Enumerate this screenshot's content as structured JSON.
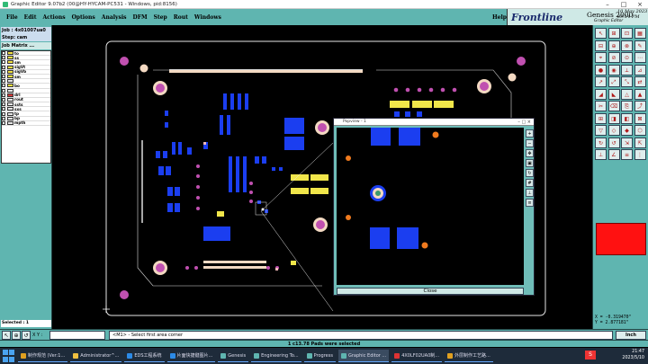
{
  "window": {
    "title": "Graphic Editor 9.07b2 (00@HY-HYCAM-PC531 - Windows, pid:8156)"
  },
  "menu": {
    "file": "File",
    "edit": "Edit",
    "actions": "Actions",
    "options": "Options",
    "analysis": "Analysis",
    "dfm": "DFM",
    "step": "Step",
    "rout": "Rout",
    "windows": "Windows",
    "help": "Help"
  },
  "brand": {
    "name": "Frontline",
    "product": "Genesis 2000",
    "subtitle": "Graphic Editor",
    "date": "10 May 2023",
    "time": "09:14 PM"
  },
  "left": {
    "job": "Job : 4x01007ua0",
    "step": "Step: cam",
    "matrix_title": "Job Matrix ...",
    "layers": [
      {
        "name": "to",
        "color": "yellow"
      },
      {
        "name": "ss",
        "color": "yellow"
      },
      {
        "name": "sm",
        "color": "yellow"
      },
      {
        "name": "sigVt",
        "color": "yellow"
      },
      {
        "name": "sigVb",
        "color": "yellow"
      },
      {
        "name": "sm",
        "color": "yellow"
      },
      {
        "name": "",
        "color": "none"
      },
      {
        "name": "bo",
        "color": "yellow"
      },
      {
        "name": "",
        "color": "none"
      },
      {
        "name": "drl",
        "color": "red"
      },
      {
        "name": "rout",
        "color": "white"
      },
      {
        "name": "ssts",
        "color": "white"
      },
      {
        "name": "sxs",
        "color": "white"
      },
      {
        "name": "tp",
        "color": "white"
      },
      {
        "name": "bp",
        "color": "white"
      },
      {
        "name": "mpth",
        "color": "white"
      }
    ],
    "status": "Selected : 1"
  },
  "popup": {
    "title": "Popview - 1",
    "close": "Close"
  },
  "tools": {
    "coords_x": "X = -0.319470\"",
    "coords_y": "Y = 2.877181\""
  },
  "cmd": {
    "xy_label": "X Y :",
    "input_value": "",
    "message": "<M1> - Select first area corner",
    "units": "Inch"
  },
  "status_line": "1 c13.78 Pads were selected",
  "taskbar": {
    "items": [
      {
        "label": "制作规范 (Ver:1...",
        "color": "#e0a020"
      },
      {
        "label": "Administrator^...",
        "color": "#f0c040"
      },
      {
        "label": "EDS工程系统",
        "color": "#2c8ae6"
      },
      {
        "label": "片面快捷键图片...",
        "color": "#2c8ae6"
      },
      {
        "label": "Genesis",
        "color": "#5fb5b0"
      },
      {
        "label": "Engineering To...",
        "color": "#5fb5b0"
      },
      {
        "label": "Progress",
        "color": "#5fb5b0"
      },
      {
        "label": "Graphic Editor ...",
        "color": "#5fb5b0"
      },
      {
        "label": "4X0LF02UA0制...",
        "color": "#d33"
      },
      {
        "label": "外层制作工艺路...",
        "color": "#e0a020"
      }
    ],
    "ime": "S",
    "time": "21:47",
    "date": "2023/5/10"
  }
}
